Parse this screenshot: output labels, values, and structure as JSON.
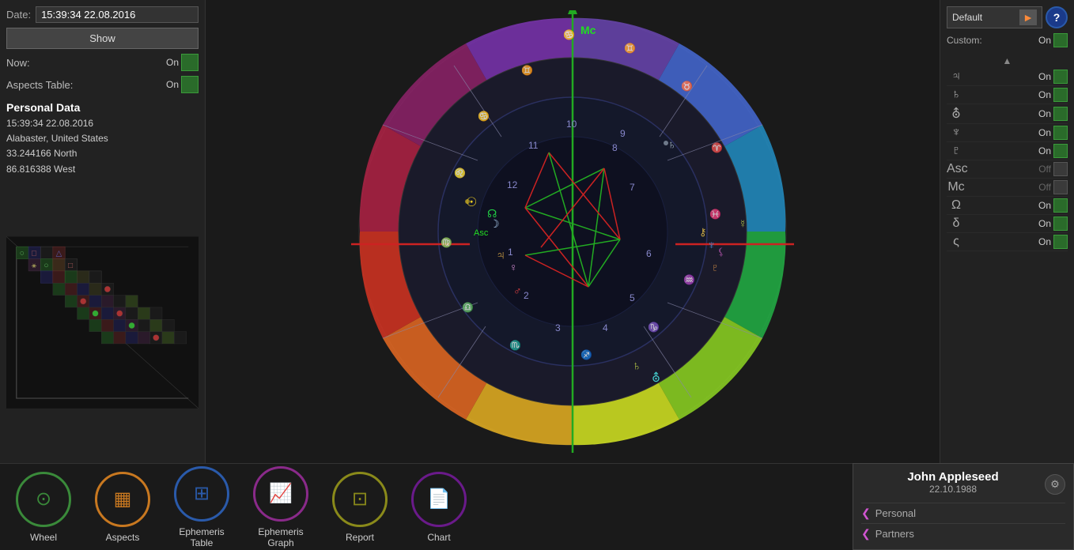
{
  "header": {
    "date_label": "Date:",
    "date_value": "15:39:34 22.08.2016",
    "show_button": "Show"
  },
  "toggles": {
    "now_label": "Now:",
    "now_state": "On",
    "aspects_table_label": "Aspects Table:",
    "aspects_table_state": "On"
  },
  "personal_data": {
    "title": "Personal Data",
    "datetime": "15:39:34 22.08.2016",
    "location": "Alabaster, United States",
    "lat": "33.244166 North",
    "lon": "86.816388 West"
  },
  "right_panel": {
    "dropdown_label": "Default",
    "custom_label": "Custom:",
    "custom_state": "On",
    "planets": [
      {
        "symbol": "♃",
        "name": "jupiter",
        "state": "On",
        "on": true
      },
      {
        "symbol": "♄",
        "name": "saturn",
        "state": "On",
        "on": true
      },
      {
        "symbol": "⛢",
        "name": "uranus",
        "state": "On",
        "on": true
      },
      {
        "symbol": "♆",
        "name": "neptune",
        "state": "On",
        "on": true
      },
      {
        "symbol": "♇",
        "name": "pluto",
        "state": "On",
        "on": true
      },
      {
        "symbol": "Asc",
        "name": "ascendant",
        "state": "Off",
        "on": false
      },
      {
        "symbol": "Mc",
        "name": "midheaven",
        "state": "Off",
        "on": false
      },
      {
        "symbol": "Ω",
        "name": "node",
        "state": "On",
        "on": true
      },
      {
        "symbol": "δ",
        "name": "lilith",
        "state": "On",
        "on": true
      },
      {
        "symbol": "ς",
        "name": "chiron",
        "state": "On",
        "on": true
      }
    ]
  },
  "bottom_nav": [
    {
      "id": "wheel",
      "label": "Wheel",
      "color": "#3a8a3a",
      "icon": "⊙"
    },
    {
      "id": "aspects",
      "label": "Aspects",
      "color": "#c87820",
      "icon": "▦"
    },
    {
      "id": "ephemeris-table",
      "label": "Ephemeris\nTable",
      "color": "#2a5aaa",
      "icon": "⊞"
    },
    {
      "id": "ephemeris-graph",
      "label": "Ephemeris\nGraph",
      "color": "#8a2a8a",
      "icon": "📈"
    },
    {
      "id": "report",
      "label": "Report",
      "color": "#8a8a1a",
      "icon": "⊡"
    },
    {
      "id": "chart",
      "label": "Chart",
      "color": "#6a1a8a",
      "icon": "📄"
    }
  ],
  "bottom_card": {
    "name": "John Appleseed",
    "date": "22.10.1988",
    "nav_items": [
      {
        "label": "Personal"
      },
      {
        "label": "Partners"
      }
    ]
  }
}
